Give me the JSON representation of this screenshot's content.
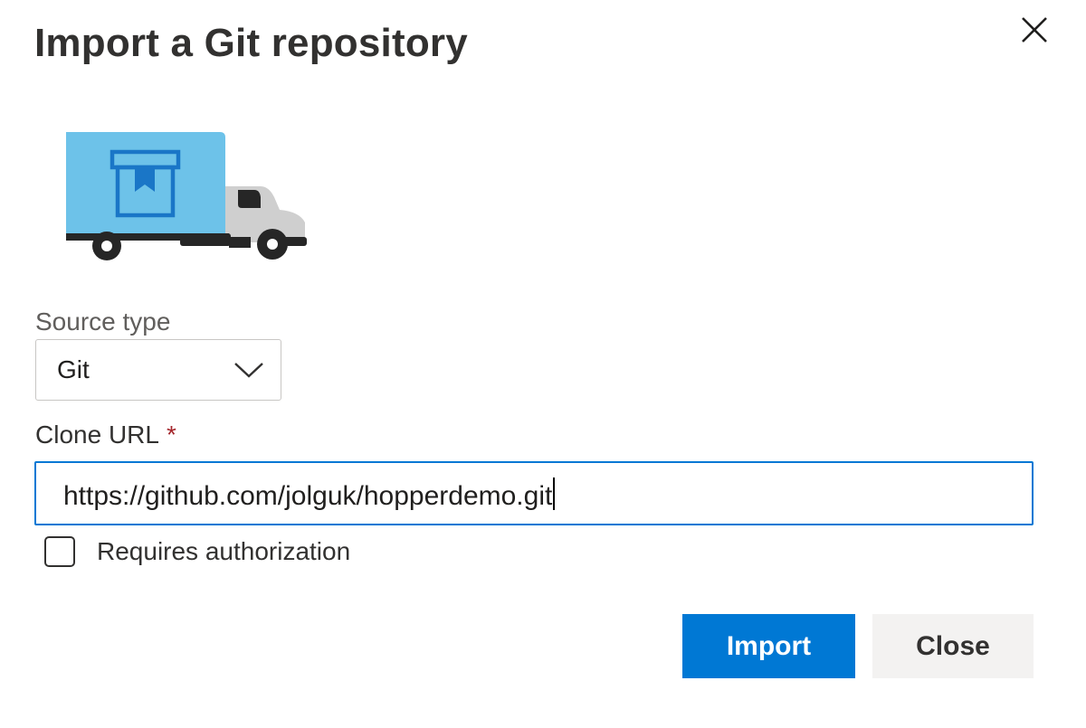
{
  "dialog": {
    "title": "Import a Git repository",
    "close_icon": "close-icon"
  },
  "illustration": {
    "icon": "moving-truck-icon",
    "colors": {
      "cargo": "#6dc2e9",
      "box": "#1a76c7",
      "cab": "#cfcfcf",
      "chassis": "#262626"
    }
  },
  "source_type": {
    "label": "Source type",
    "selected": "Git",
    "chevron_icon": "chevron-down-icon"
  },
  "clone_url": {
    "label": "Clone URL",
    "required_marker": "*",
    "value": "https://github.com/jolguk/hopperdemo.git"
  },
  "requires_auth": {
    "label": "Requires authorization",
    "checked": false
  },
  "buttons": {
    "import_label": "Import",
    "close_label": "Close"
  },
  "colors": {
    "accent": "#0078d4",
    "required": "#a4262c",
    "secondary_button": "#f3f2f1"
  }
}
